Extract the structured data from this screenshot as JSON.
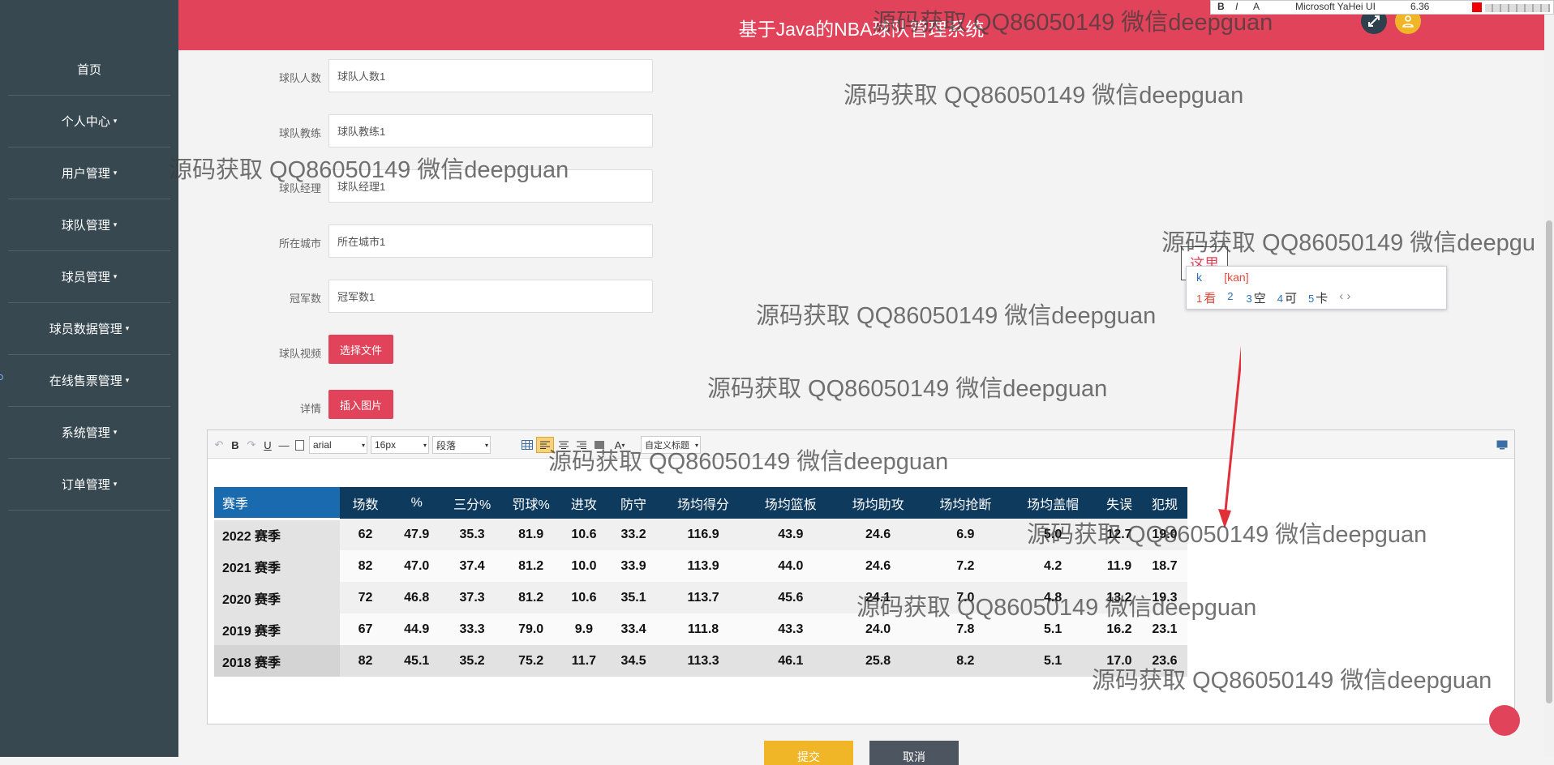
{
  "header": {
    "title": "基于Java的NBA球队管理系统"
  },
  "sidebar": {
    "items": [
      {
        "label": "首页",
        "caret": ""
      },
      {
        "label": "个人中心",
        "caret": "▾"
      },
      {
        "label": "用户管理",
        "caret": "▾"
      },
      {
        "label": "球队管理",
        "caret": "▾"
      },
      {
        "label": "球员管理",
        "caret": "▾"
      },
      {
        "label": "球员数据管理",
        "caret": "▾"
      },
      {
        "label": "在线售票管理",
        "caret": "▾"
      },
      {
        "label": "系统管理",
        "caret": "▾"
      },
      {
        "label": "订单管理",
        "caret": "▾"
      }
    ]
  },
  "form": {
    "fields": [
      {
        "label": "球队人数",
        "value": "球队人数1"
      },
      {
        "label": "球队教练",
        "value": "球队教练1"
      },
      {
        "label": "球队经理",
        "value": "球队经理1"
      },
      {
        "label": "所在城市",
        "value": "所在城市1"
      },
      {
        "label": "冠军数",
        "value": "冠军数1"
      }
    ],
    "video_label": "球队视频",
    "video_button": "选择文件",
    "detail_label": "详情",
    "detail_button": "插入图片",
    "submit": "提交",
    "cancel": "取消"
  },
  "editor": {
    "toolbar": {
      "undo": "↶",
      "bold": "B",
      "redo": "↷",
      "underline": "U",
      "hr": "—",
      "font": "arial",
      "size": "16px",
      "paragraph": "段落",
      "fontcolor": "A",
      "custom_title": "自定义标题"
    },
    "table": {
      "headers": [
        "赛季",
        "场数",
        "%",
        "三分%",
        "罚球%",
        "进攻",
        "防守",
        "场均得分",
        "场均篮板",
        "场均助攻",
        "场均抢断",
        "场均盖帽",
        "失误",
        "犯规"
      ],
      "rows": [
        [
          "2022 赛季",
          "62",
          "47.9",
          "35.3",
          "81.9",
          "10.6",
          "33.2",
          "116.9",
          "43.9",
          "24.6",
          "6.9",
          "5.0",
          "12.7",
          "19.0"
        ],
        [
          "2021 赛季",
          "82",
          "47.0",
          "37.4",
          "81.2",
          "10.0",
          "33.9",
          "113.9",
          "44.0",
          "24.6",
          "7.2",
          "4.2",
          "11.9",
          "18.7"
        ],
        [
          "2020 赛季",
          "72",
          "46.8",
          "37.3",
          "81.2",
          "10.6",
          "35.1",
          "113.7",
          "45.6",
          "24.1",
          "7.0",
          "4.8",
          "13.2",
          "19.3"
        ],
        [
          "2019 赛季",
          "67",
          "44.9",
          "33.3",
          "79.0",
          "9.9",
          "33.4",
          "111.8",
          "43.3",
          "24.0",
          "7.8",
          "5.1",
          "16.2",
          "23.1"
        ],
        [
          "2018 赛季",
          "82",
          "45.1",
          "35.2",
          "75.2",
          "11.7",
          "34.5",
          "113.3",
          "46.1",
          "25.8",
          "8.2",
          "5.1",
          "17.0",
          "23.6"
        ]
      ]
    }
  },
  "watermark": "源码获取 QQ86050149 微信deepguan",
  "watermark_cut": "源码获取 QQ86050149 微信deepgu",
  "ime": {
    "composition": "[kan]",
    "typed": "k",
    "hint": "这里",
    "candidates": [
      {
        "num": "1",
        "text": "看"
      },
      {
        "num": "2",
        "text": ""
      },
      {
        "num": "3",
        "text": "空"
      },
      {
        "num": "4",
        "text": "可"
      },
      {
        "num": "5",
        "text": "卡"
      }
    ],
    "pager": "‹ ›"
  },
  "floatbar": {
    "font": "Microsoft YaHei UI",
    "size": "6.36"
  },
  "colors": {
    "header": "#e0435a",
    "sidebar": "#374850",
    "table_header": "#0e3a5e",
    "season_header": "#1a6aaf",
    "submit": "#f0b628",
    "cancel": "#4c5560"
  }
}
